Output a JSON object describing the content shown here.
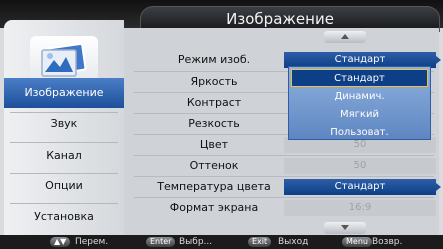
{
  "title": "Изображение",
  "sidebar": {
    "items": [
      {
        "label": "Изображение",
        "active": true
      },
      {
        "label": "Звук"
      },
      {
        "label": "Канал"
      },
      {
        "label": "Опции"
      },
      {
        "label": "Установка"
      }
    ]
  },
  "menu": {
    "rows": [
      {
        "label": "Режим изоб.",
        "value": "Стандарт"
      },
      {
        "label": "Яркость",
        "value": ""
      },
      {
        "label": "Контраст",
        "value": ""
      },
      {
        "label": "Резкость",
        "value": ""
      },
      {
        "label": "Цвет",
        "value": "50"
      },
      {
        "label": "Оттенок",
        "value": "50"
      },
      {
        "label": "Температура цвета",
        "value": "Стандарт"
      },
      {
        "label": "Формат экрана",
        "value": "16:9"
      }
    ]
  },
  "dropdown": {
    "options": [
      "Стандарт",
      "Динамич.",
      "Мягкий",
      "Пользоват."
    ],
    "selected": "Стандарт"
  },
  "footer": {
    "nav_key": "▲▼",
    "nav_label": "Перем.",
    "enter_key": "Enter",
    "enter_label": "Выбр...",
    "exit_key": "Exit",
    "exit_label": "Выход",
    "menu_key": "Menu",
    "menu_label": "Возвр."
  },
  "colors": {
    "accent": "#1d4f9a",
    "highlight_border": "#f0c040"
  }
}
